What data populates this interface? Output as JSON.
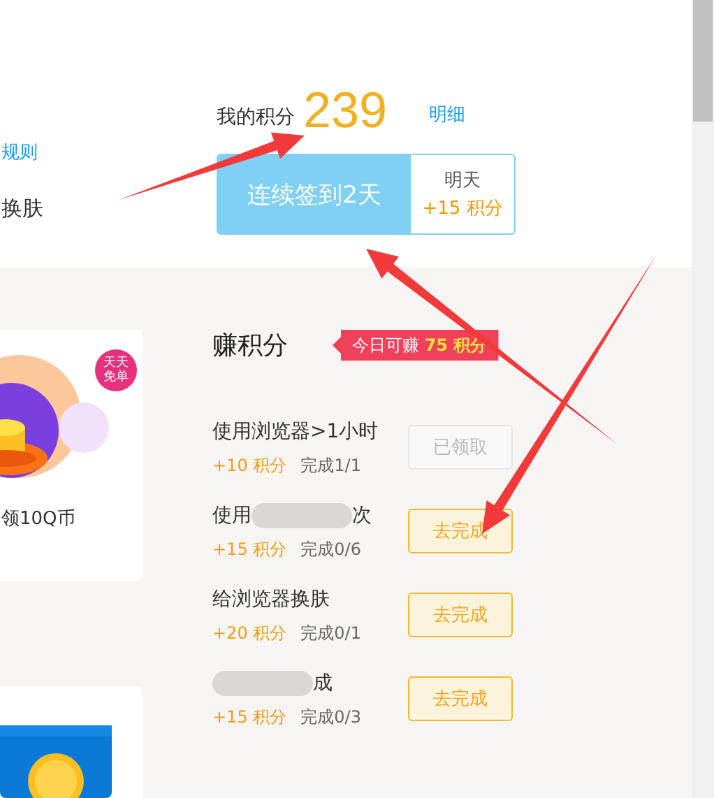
{
  "left_panel": {
    "rules_link": "规则",
    "skin_label": "换肤",
    "promo_card": {
      "kind": "picture",
      "badge": "天天免单",
      "caption": "领10Q币"
    }
  },
  "points": {
    "label": "我的积分",
    "value": "239",
    "detail_link": "明细"
  },
  "checkin": {
    "streak": "连续签到2天",
    "tomorrow_label": "明天",
    "tomorrow_points": "+15 积分"
  },
  "earn": {
    "title": "赚积分",
    "badge": "今日可赚 **75 积分**"
  },
  "tasks": [
    {
      "title_segments": [
        {
          "kind": "text",
          "text": "使用浏览器>1小时"
        }
      ],
      "points": "+10 积分",
      "progress": "完成1/1",
      "button": "已领取",
      "done": true
    },
    {
      "title_segments": [
        {
          "kind": "text",
          "text": "使用"
        },
        {
          "kind": "blur"
        },
        {
          "kind": "text",
          "text": "次"
        }
      ],
      "points": "+15 积分",
      "progress": "完成0/6",
      "button": "去完成",
      "done": false
    },
    {
      "title_segments": [
        {
          "kind": "text",
          "text": "给浏览器换肤"
        }
      ],
      "points": "+20 积分",
      "progress": "完成0/1",
      "button": "去完成",
      "done": false
    },
    {
      "title_segments": [
        {
          "kind": "blur"
        },
        {
          "kind": "text",
          "text": "成"
        }
      ],
      "points": "+15 积分",
      "progress": "完成0/3",
      "button": "去完成",
      "done": false
    }
  ]
}
